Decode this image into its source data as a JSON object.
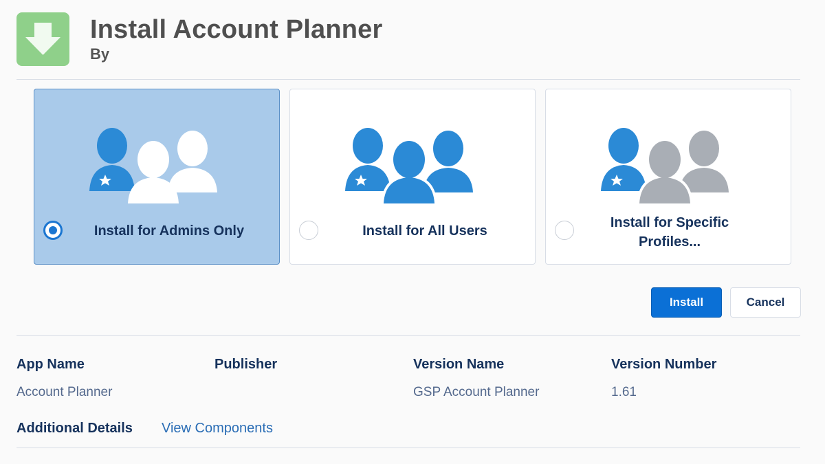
{
  "header": {
    "title": "Install Account Planner",
    "by": "By"
  },
  "options": [
    {
      "label": "Install for Admins Only",
      "selected": true
    },
    {
      "label": "Install for All Users",
      "selected": false
    },
    {
      "label": "Install for Specific Profiles...",
      "selected": false
    }
  ],
  "buttons": {
    "install": "Install",
    "cancel": "Cancel"
  },
  "details": {
    "app_name_label": "App Name",
    "app_name_value": "Account Planner",
    "publisher_label": "Publisher",
    "publisher_value": "",
    "version_name_label": "Version Name",
    "version_name_value": "GSP Account Planner",
    "version_number_label": "Version Number",
    "version_number_value": "1.61",
    "additional_label": "Additional Details",
    "view_components": "View Components"
  },
  "colors": {
    "selected_card": "#a9caea",
    "admin_user": "#2b8ad6",
    "user_blue": "#2b8ad6",
    "user_gray": "#a9aeb5",
    "install_button": "#0b70d6",
    "app_icon": "#8fd08a"
  }
}
